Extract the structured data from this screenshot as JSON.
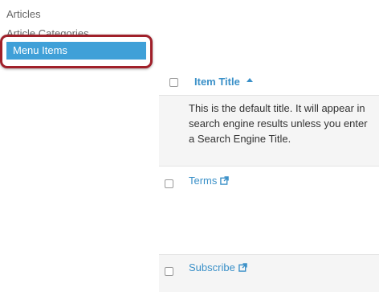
{
  "sidebar": {
    "items": [
      {
        "label": "Articles"
      },
      {
        "label": "Article Categories"
      },
      {
        "label": "Menu Items",
        "active": true
      }
    ]
  },
  "table": {
    "header": {
      "column": "Item Title",
      "sort": "ascending",
      "sort_icon": "sort-up-icon"
    },
    "description": "This is the default title. It will appear in search engine results unless you enter a Search Engine Title.",
    "rows": [
      {
        "title": "Terms",
        "icon": "external-link-icon"
      },
      {
        "title": "Subscribe",
        "icon": "external-link-icon"
      }
    ]
  },
  "colors": {
    "accent": "#3fa0d8",
    "link": "#3a90c8",
    "highlight_border": "#a0202a"
  }
}
